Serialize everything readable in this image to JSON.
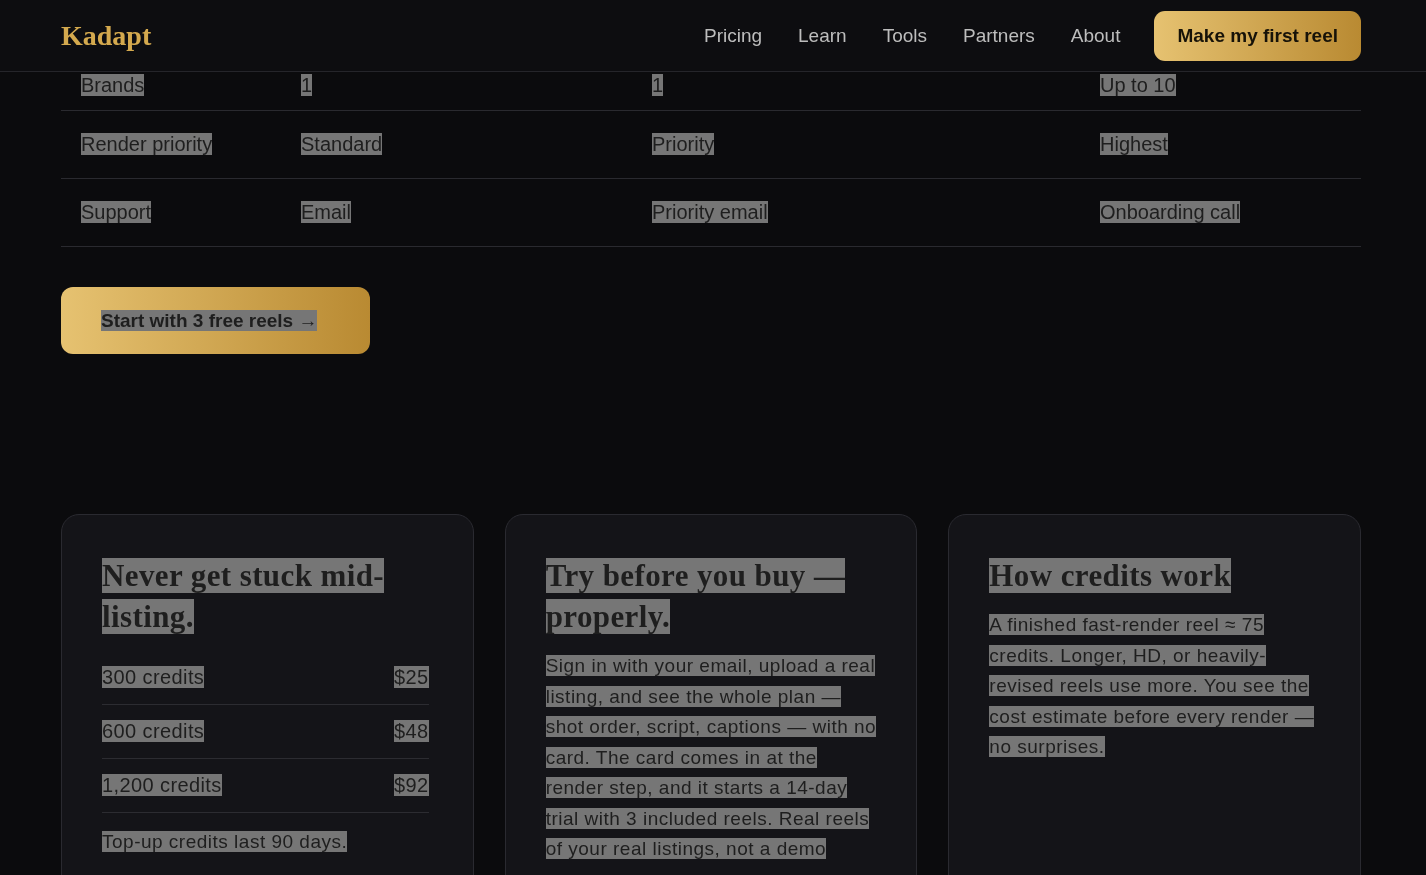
{
  "text_selected": true,
  "nav": {
    "logo": "Kadapt",
    "links": [
      "Pricing",
      "Learn",
      "Tools",
      "Partners",
      "About"
    ],
    "cta": "Make my first reel"
  },
  "table": {
    "rows": [
      {
        "cells": [
          "Brands",
          "1",
          "1",
          "Up to 10"
        ]
      },
      {
        "cells": [
          "Render priority",
          "Standard",
          "Priority",
          "Highest"
        ]
      },
      {
        "cells": [
          "Support",
          "Email",
          "Priority email",
          "Onboarding call"
        ]
      }
    ]
  },
  "start_button": "Start with 3 free reels →",
  "cards": [
    {
      "kind": "prices",
      "title": "Never get stuck mid-listing.",
      "prices": [
        {
          "credits": "300 credits",
          "price": "$25"
        },
        {
          "credits": "600 credits",
          "price": "$48"
        },
        {
          "credits": "1,200 credits",
          "price": "$92"
        }
      ],
      "note": "Top-up credits last 90 days."
    },
    {
      "kind": "text",
      "title": "Try before you buy — properly.",
      "body": "Sign in with your email, upload a real listing, and see the whole plan — shot order, script, captions — with no card. The card comes in at the render step, and it starts a 14-day trial with 3 included reels. Real reels of your real listings, not a demo"
    },
    {
      "kind": "text",
      "title": "How credits work",
      "body": "A finished fast-render reel ≈ 75 credits. Longer, HD, or heavily-revised reels use more. You see the cost estimate before every render — no surprises."
    }
  ]
}
